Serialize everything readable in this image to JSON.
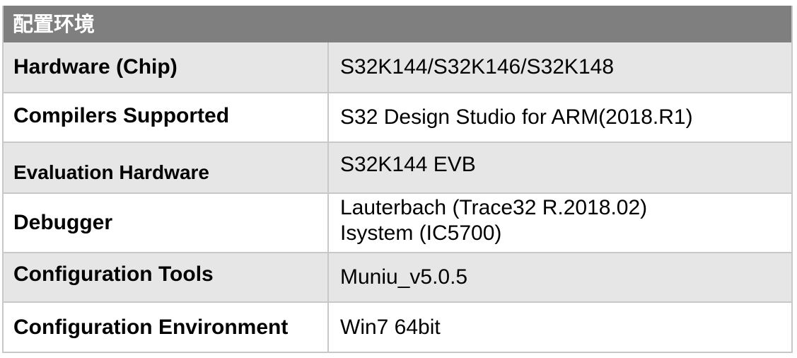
{
  "table": {
    "title": "配置环境",
    "rows": [
      {
        "label": "Hardware (Chip)",
        "value": "S32K144/S32K146/S32K148"
      },
      {
        "label": "Compilers Supported",
        "value": "S32 Design Studio for ARM(2018.R1)"
      },
      {
        "label": "Evaluation Hardware",
        "value": "S32K144 EVB"
      },
      {
        "label": "Debugger",
        "value": "Lauterbach (Trace32 R.2018.02)\nIsystem (IC5700)"
      },
      {
        "label": "Configuration Tools",
        "value": "Muniu_v5.0.5"
      },
      {
        "label": "Configuration Environment",
        "value": "Win7 64bit"
      }
    ]
  },
  "colors": {
    "header_bg": "#7f7f7f",
    "row_shaded": "#e6e6e6",
    "row_white": "#ffffff",
    "border": "#c8c8c8"
  }
}
